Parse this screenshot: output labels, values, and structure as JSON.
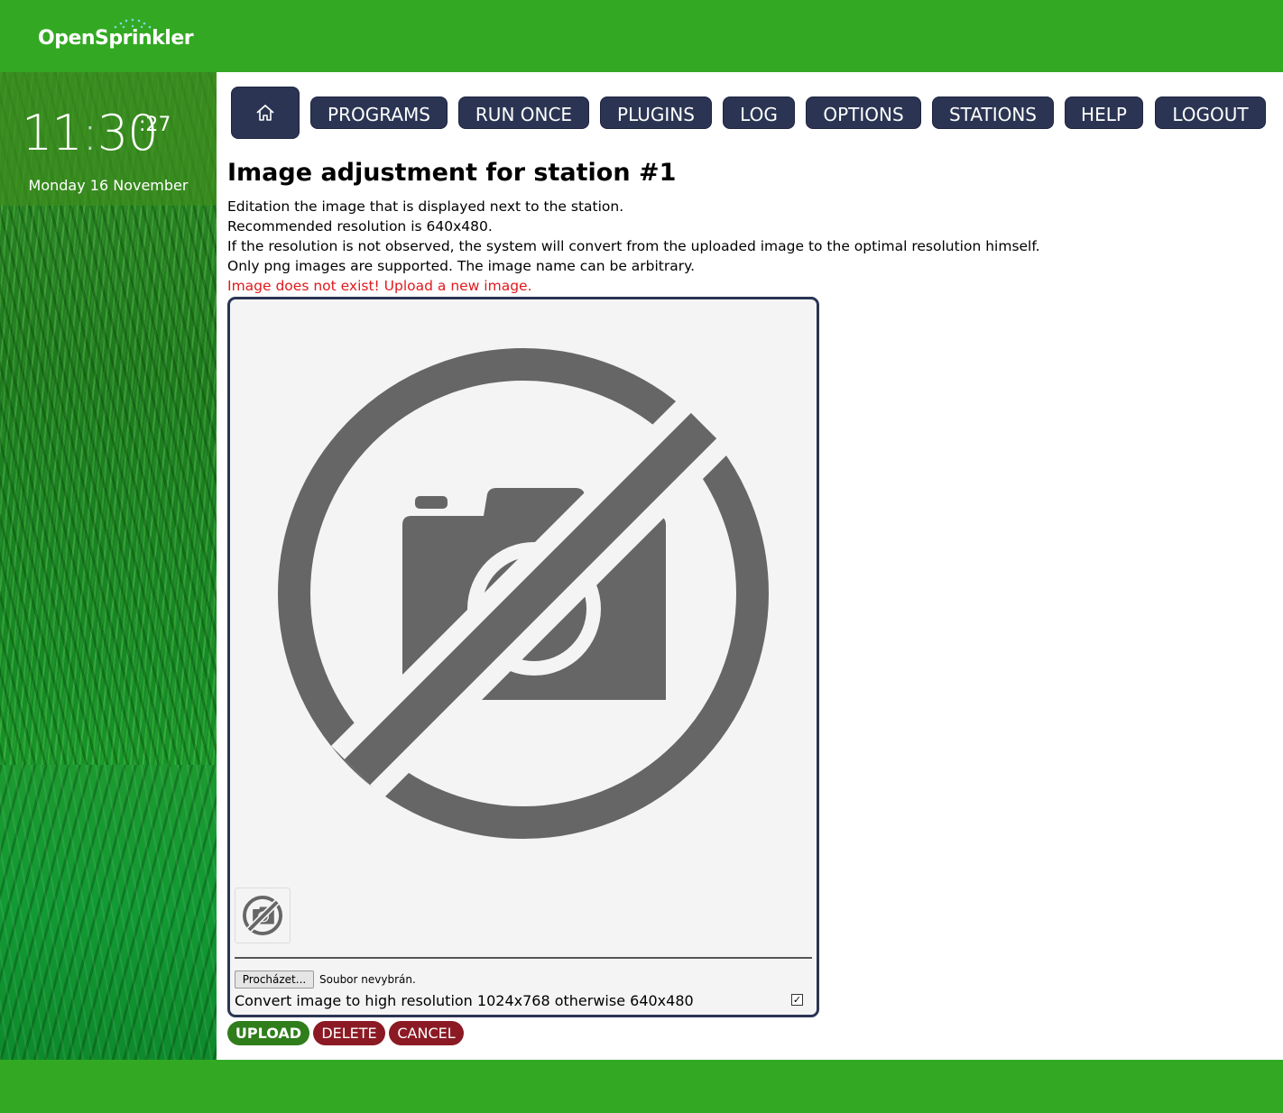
{
  "header": {
    "logo_text": "OpenSprinkler",
    "brand_color": "#33a923"
  },
  "sidebar": {
    "clock": {
      "hours": "11",
      "minutes": "30",
      "seconds": "27",
      "date": "Monday 16 November"
    }
  },
  "nav": {
    "home_icon": "home-icon",
    "items": [
      {
        "label": "PROGRAMS"
      },
      {
        "label": "RUN ONCE"
      },
      {
        "label": "PLUGINS"
      },
      {
        "label": "LOG"
      },
      {
        "label": "OPTIONS"
      },
      {
        "label": "STATIONS"
      },
      {
        "label": "HELP"
      },
      {
        "label": "LOGOUT"
      }
    ],
    "button_color": "#2b3553"
  },
  "main": {
    "title": "Image adjustment for station #1",
    "description_lines": [
      "Editation the image that is displayed next to the station.",
      "Recommended resolution is 640x480.",
      "If the resolution is not observed, the system will convert from the uploaded image to the optimal resolution himself.",
      "Only png images are supported. The image name can be arbitrary."
    ],
    "error": "Image does not exist! Upload a new image.",
    "error_color": "#e0191c"
  },
  "image_panel": {
    "placeholder_icon": "no-camera-icon",
    "browse_label": "Procházet...",
    "no_file_text": "Soubor nevybrán.",
    "convert_label": "Convert image to high resolution 1024x768 otherwise 640x480",
    "convert_checked": true
  },
  "actions": {
    "upload_label": "UPLOAD",
    "delete_label": "DELETE",
    "cancel_label": "CANCEL",
    "upload_color": "#2f7d1b",
    "delete_color": "#8b1a24"
  }
}
